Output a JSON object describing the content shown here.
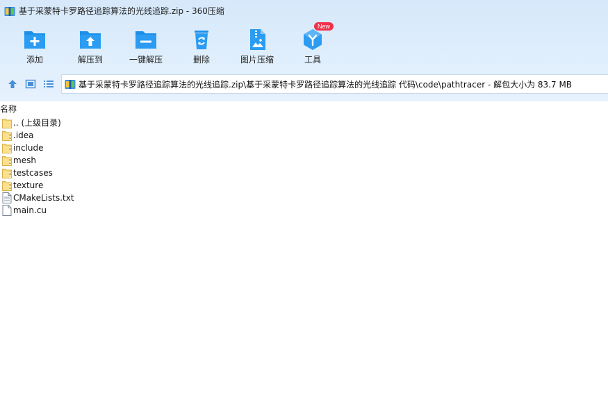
{
  "window": {
    "title": "基于采蒙特卡罗路径追踪算法的光线追踪.zip - 360压缩",
    "app_icon": "archive-icon"
  },
  "toolbar": {
    "buttons": [
      {
        "label": "添加",
        "icon": "add-folder-icon"
      },
      {
        "label": "解压到",
        "icon": "extract-to-folder-icon"
      },
      {
        "label": "一键解压",
        "icon": "one-click-extract-icon"
      },
      {
        "label": "删除",
        "icon": "recycle-bin-icon"
      },
      {
        "label": "图片压缩",
        "icon": "image-compress-icon"
      },
      {
        "label": "工具",
        "icon": "tools-cube-icon",
        "badge": "New"
      }
    ],
    "accent_color": "#1e8fe8",
    "badge_color": "#f0314a"
  },
  "address": {
    "path": "基于采蒙特卡罗路径追踪算法的光线追踪.zip\\基于采蒙特卡罗路径追踪算法的光线追踪 代码\\code\\pathtracer - 解包大小为 83.7 MB"
  },
  "list": {
    "column_name": "名称",
    "items": [
      {
        "name": ".. (上级目录)",
        "type": "parent-folder"
      },
      {
        "name": ".idea",
        "type": "folder"
      },
      {
        "name": "include",
        "type": "folder"
      },
      {
        "name": "mesh",
        "type": "folder"
      },
      {
        "name": "testcases",
        "type": "folder"
      },
      {
        "name": "texture",
        "type": "folder"
      },
      {
        "name": "CMakeLists.txt",
        "type": "text-file"
      },
      {
        "name": "main.cu",
        "type": "file"
      }
    ]
  }
}
